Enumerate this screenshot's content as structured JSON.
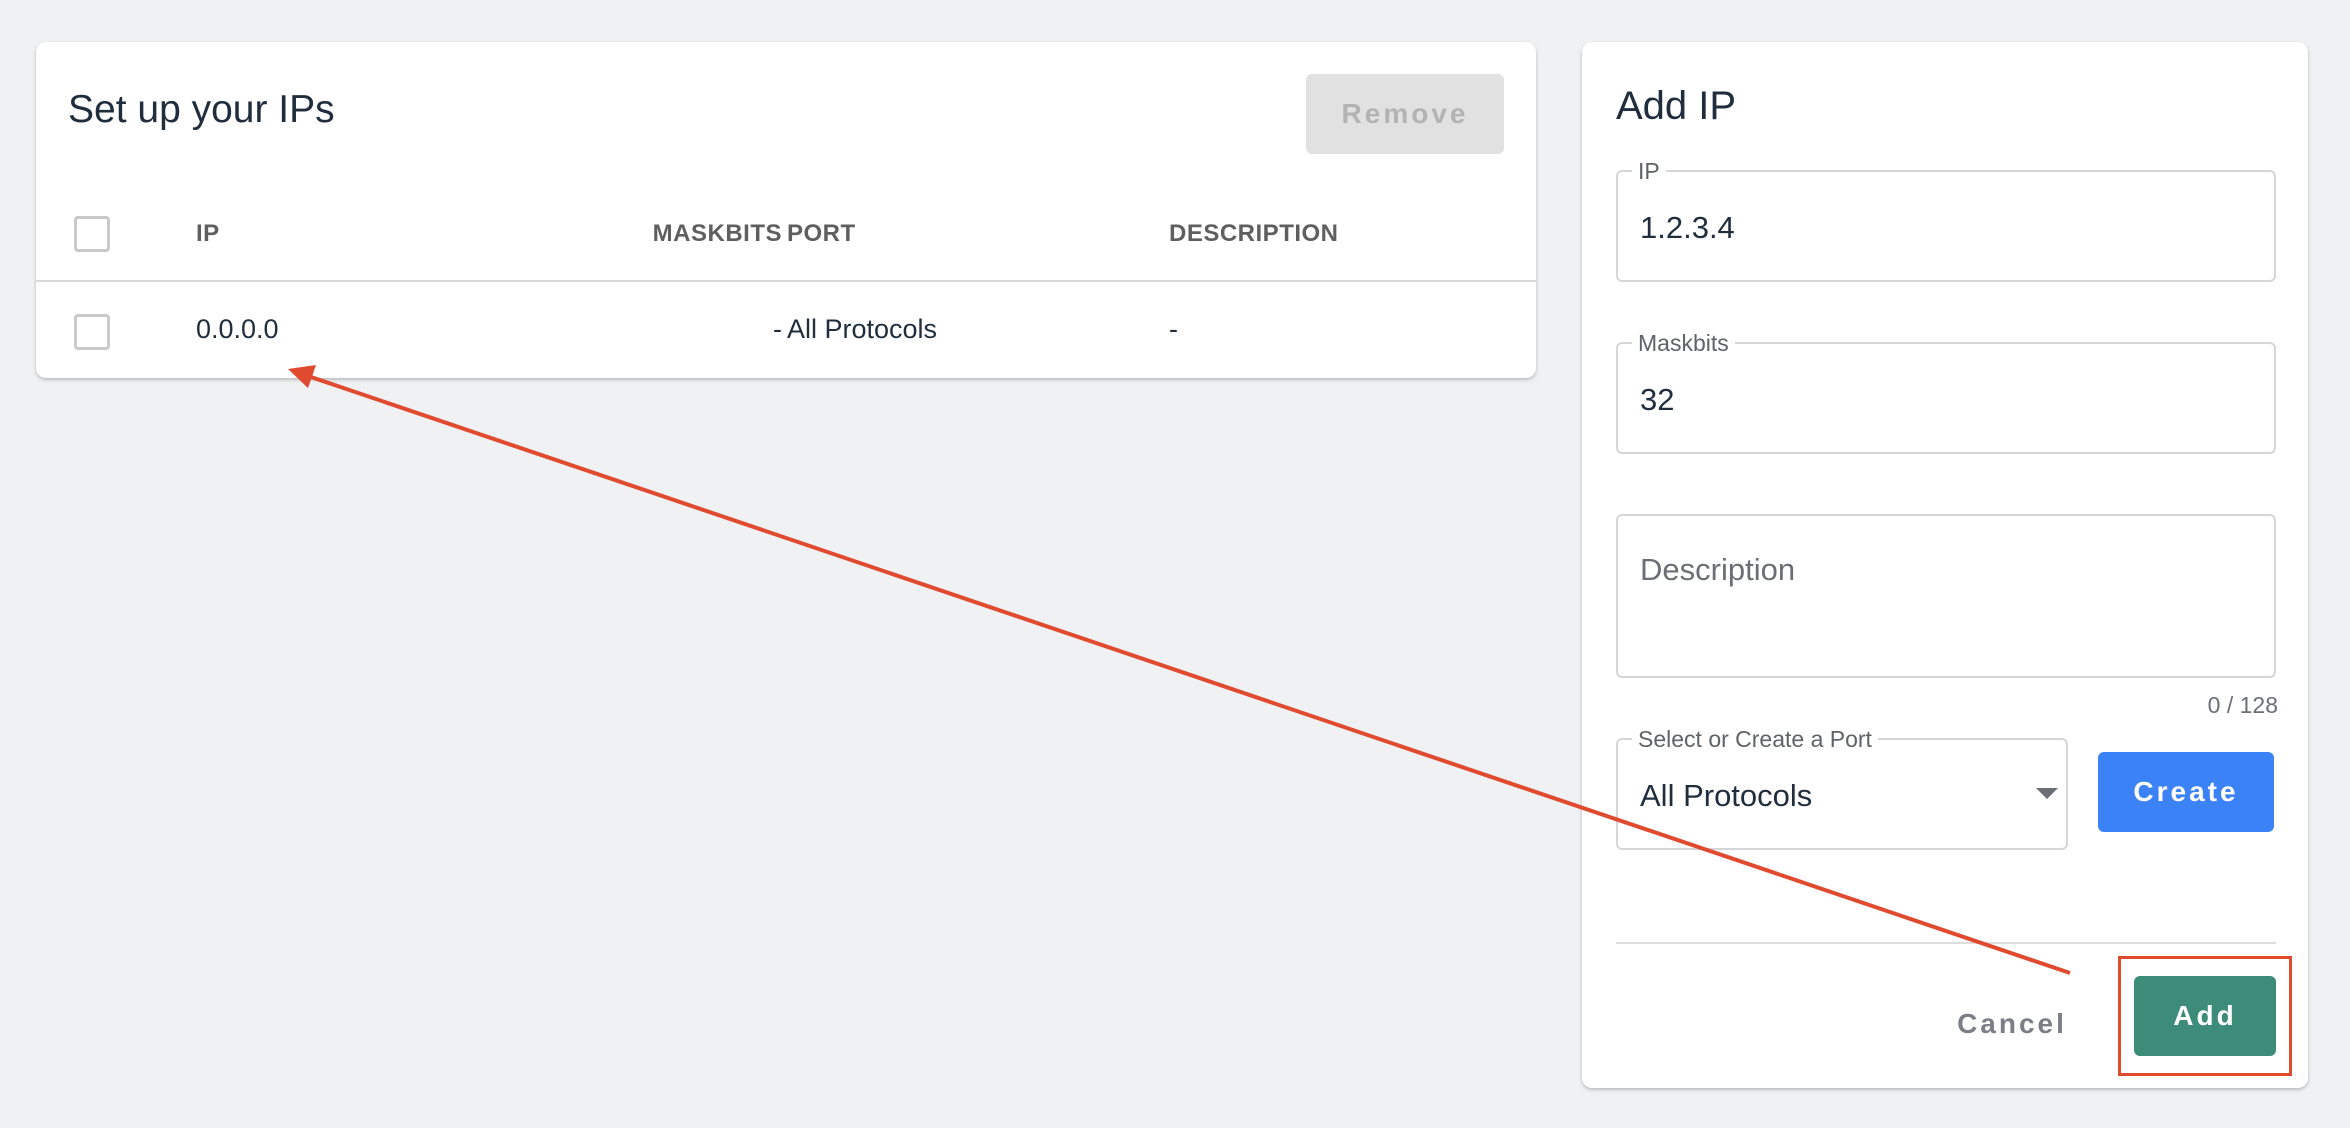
{
  "ip_table": {
    "title": "Set up your IPs",
    "remove_label": "Remove",
    "columns": [
      "IP",
      "MASKBITS",
      "PORT",
      "DESCRIPTION"
    ],
    "rows": [
      {
        "ip": "0.0.0.0",
        "maskbits": "-",
        "port": "All Protocols",
        "description": "-"
      }
    ]
  },
  "add_form": {
    "title": "Add IP",
    "ip": {
      "label": "IP",
      "value": "1.2.3.4"
    },
    "maskbits": {
      "label": "Maskbits",
      "value": "32"
    },
    "description": {
      "placeholder": "Description",
      "counter": "0 / 128"
    },
    "port": {
      "label": "Select or Create a Port",
      "value": "All Protocols"
    },
    "create_label": "Create",
    "cancel_label": "Cancel",
    "add_label": "Add"
  },
  "annotation": {
    "arrow_color": "#e04a2f"
  }
}
